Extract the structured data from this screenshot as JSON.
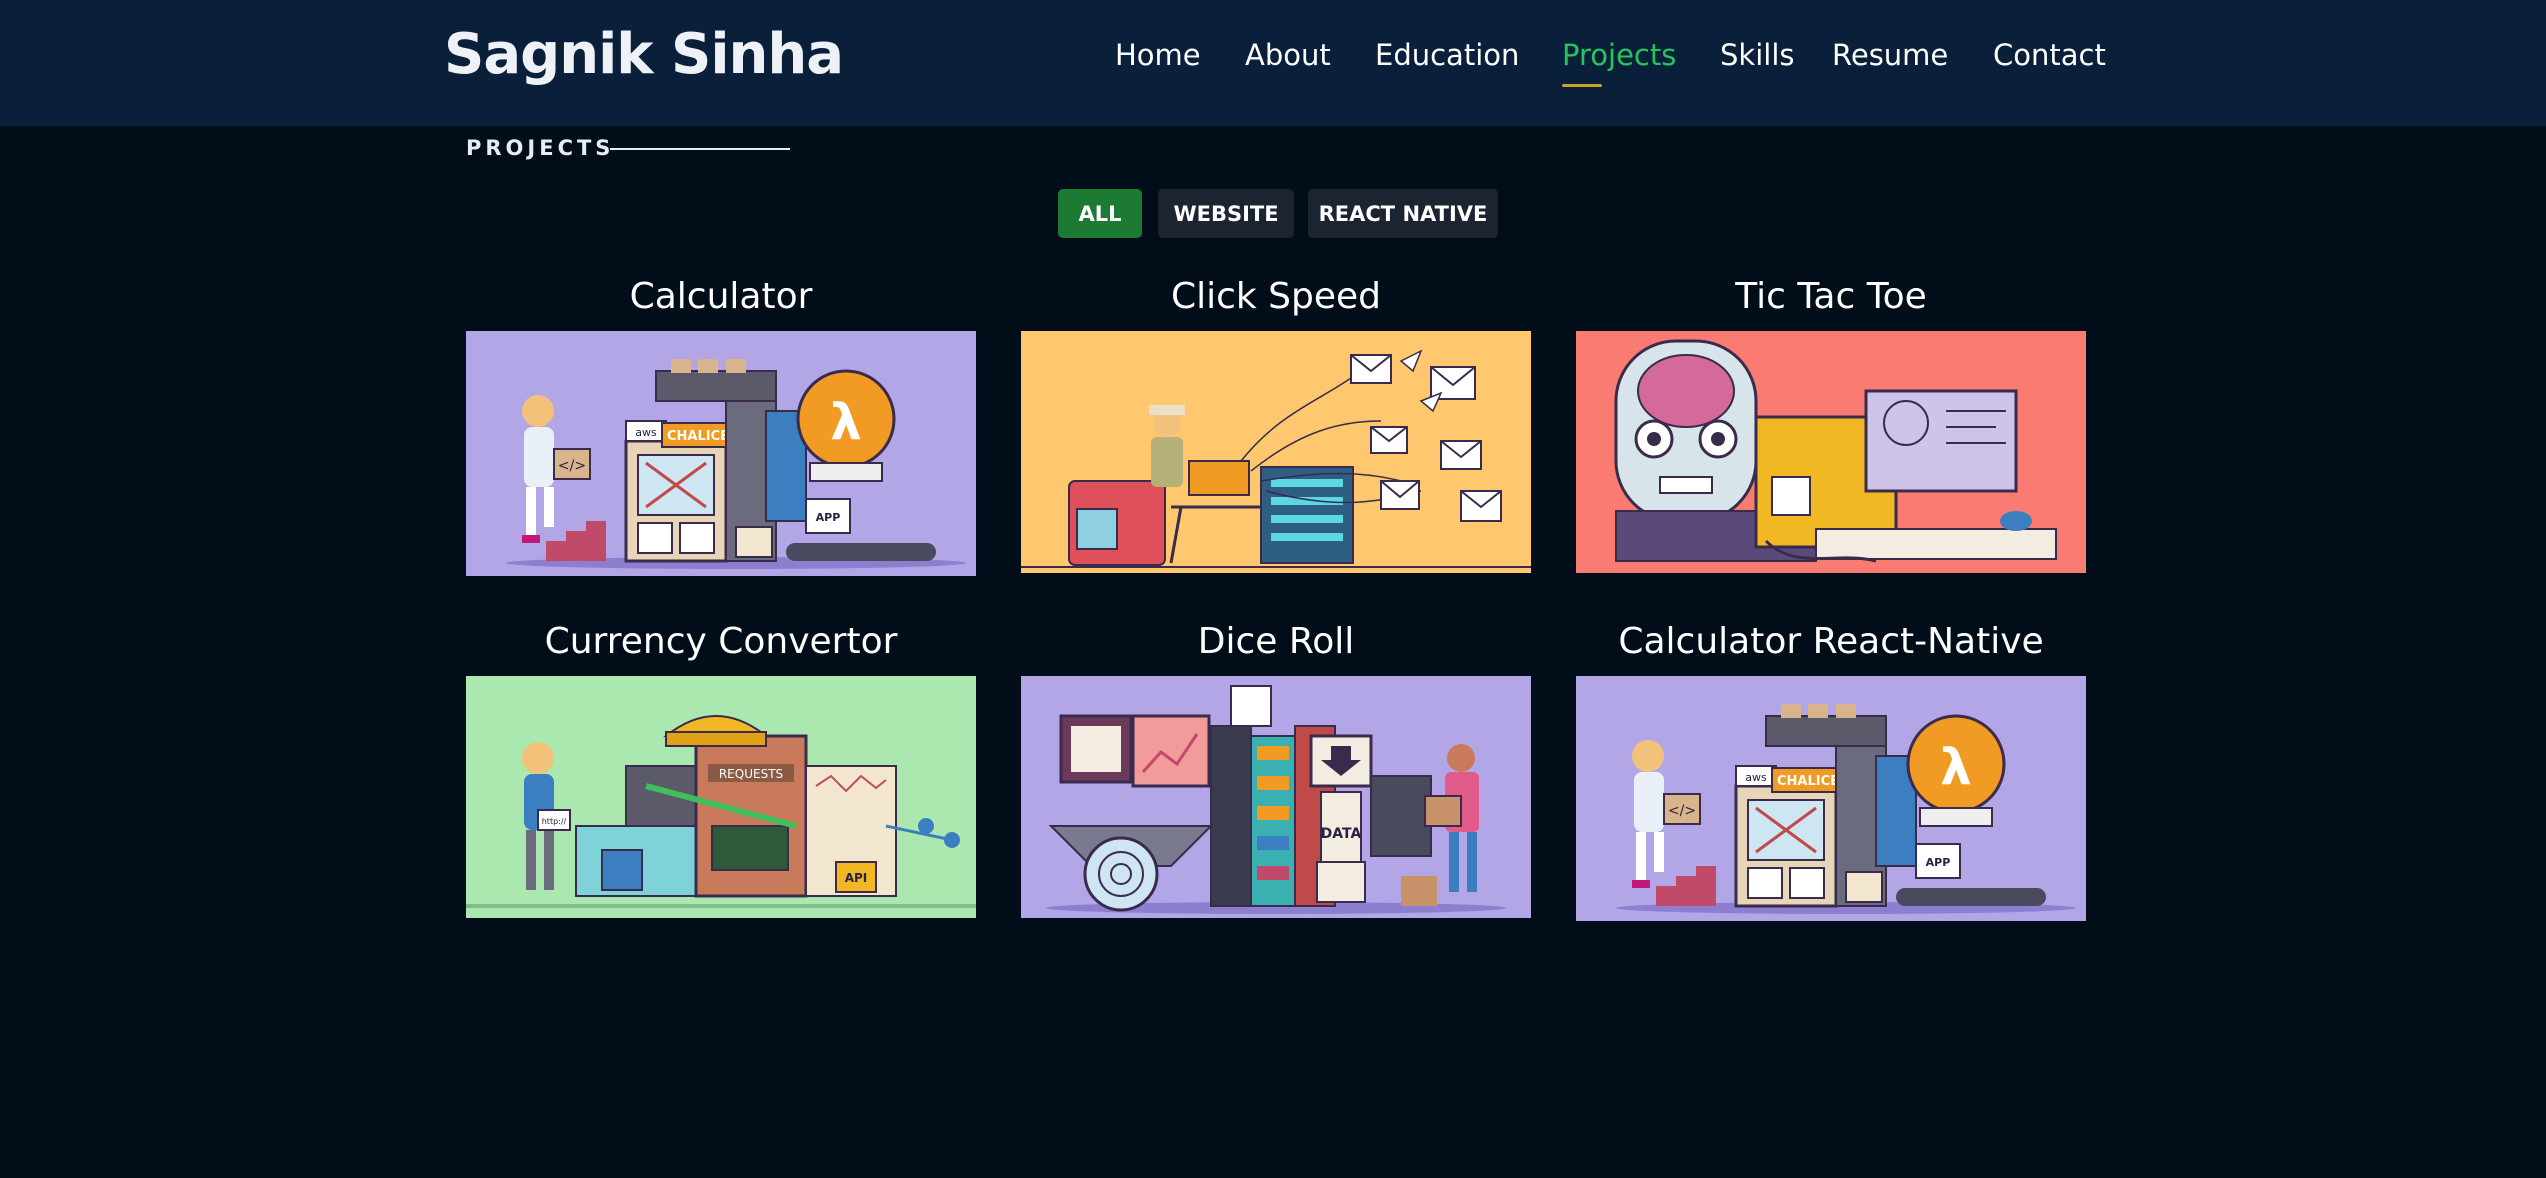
{
  "header": {
    "brand": "Sagnik Sinha",
    "nav": [
      "Home",
      "About",
      "Education",
      "Projects",
      "Skills",
      "Resume",
      "Contact"
    ],
    "active_nav": "Projects"
  },
  "section": {
    "title": "PROJECTS"
  },
  "filters": [
    {
      "label": "ALL",
      "active": true
    },
    {
      "label": "WEBSITE",
      "active": false
    },
    {
      "label": "REACT NATIVE",
      "active": false
    }
  ],
  "projects": [
    {
      "title": "Calculator",
      "bg": "#b3a6e6",
      "art": "serverless-lambda"
    },
    {
      "title": "Click Speed",
      "bg": "#ffc76e",
      "art": "paper-planes"
    },
    {
      "title": "Tic Tac Toe",
      "bg": "#fa7b72",
      "art": "robot-head"
    },
    {
      "title": "Currency Convertor",
      "bg": "#abe8b0",
      "art": "requests-api-machine"
    },
    {
      "title": "Dice Roll",
      "bg": "#b3a6e6",
      "art": "data-machine"
    },
    {
      "title": "Calculator React-Native",
      "bg": "#b3a6e6",
      "art": "serverless-lambda"
    }
  ],
  "art_text": {
    "aws": "aws",
    "chalice": "CHALICE",
    "app": "APP",
    "lambda": "λ",
    "code": "</>",
    "requests": "REQUESTS",
    "api": "API",
    "http": "http://",
    "data": "DATA"
  },
  "colors": {
    "page_bg": "#020d1a",
    "header_bg": "#0a1f3a",
    "active_nav": "#22c55e",
    "nav_underline": "#c9a227",
    "filter_active": "#1d7a34",
    "filter_idle": "#1b2430"
  }
}
